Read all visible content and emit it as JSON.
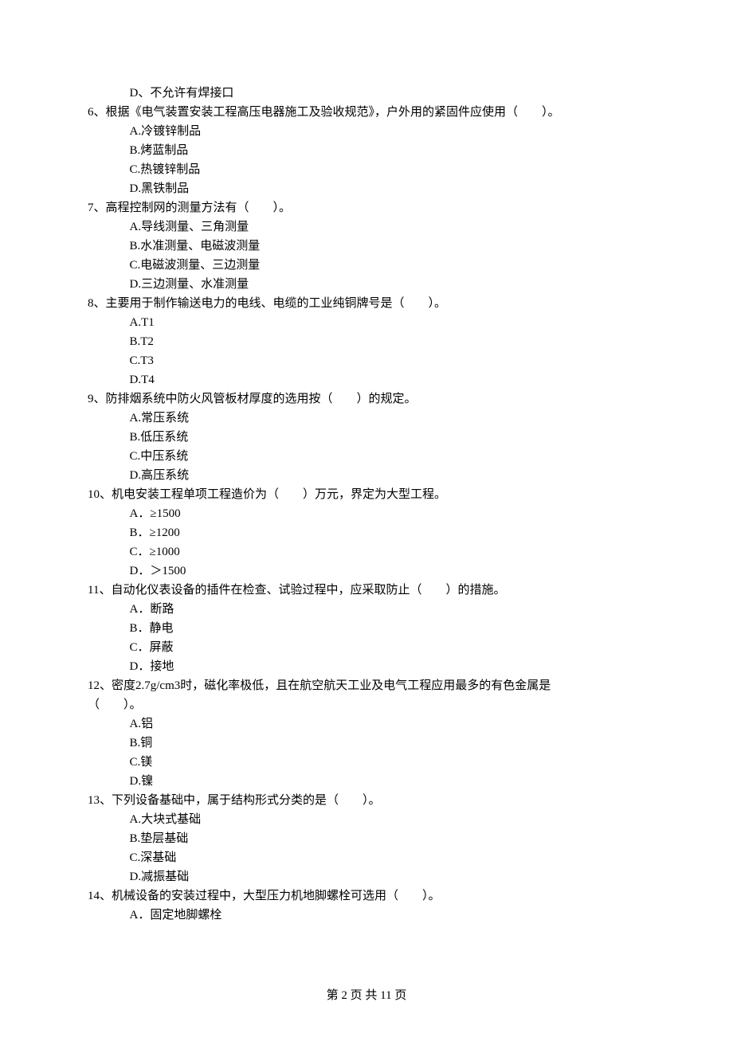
{
  "q5": {
    "optD": "D、不允许有焊接口"
  },
  "q6": {
    "stem": "6、根据《电气装置安装工程高压电器施工及验收规范》，户外用的紧固件应使用（　　）。",
    "optA": "A.冷镀锌制品",
    "optB": "B.烤蓝制品",
    "optC": "C.热镀锌制品",
    "optD": "D.黑铁制品"
  },
  "q7": {
    "stem": "7、高程控制网的测量方法有（　　）。",
    "optA": "A.导线测量、三角测量",
    "optB": "B.水准测量、电磁波测量",
    "optC": "C.电磁波测量、三边测量",
    "optD": "D.三边测量、水准测量"
  },
  "q8": {
    "stem": "8、主要用于制作输送电力的电线、电缆的工业纯铜牌号是（　　）。",
    "optA": "A.T1",
    "optB": "B.T2",
    "optC": "C.T3",
    "optD": "D.T4"
  },
  "q9": {
    "stem": "9、防排烟系统中防火风管板材厚度的选用按（　　）的规定。",
    "optA": "A.常压系统",
    "optB": "B.低压系统",
    "optC": "C.中压系统",
    "optD": "D.高压系统"
  },
  "q10": {
    "stem": "10、机电安装工程单项工程造价为（　　）万元，界定为大型工程。",
    "optA": "A．≥1500",
    "optB": "B．≥1200",
    "optC": "C．≥1000",
    "optD": "D．＞1500"
  },
  "q11": {
    "stem": "11、自动化仪表设备的插件在检查、试验过程中，应采取防止（　　）的措施。",
    "optA": "A．断路",
    "optB": "B．静电",
    "optC": "C．屏蔽",
    "optD": "D．接地"
  },
  "q12": {
    "stem1": "12、密度2.7g/cm3时，磁化率极低，且在航空航天工业及电气工程应用最多的有色金属是",
    "stem2": "（　　）。",
    "optA": "A.铝",
    "optB": "B.铜",
    "optC": "C.镁",
    "optD": "D.镍"
  },
  "q13": {
    "stem": "13、下列设备基础中，属于结构形式分类的是（　　）。",
    "optA": "A.大块式基础",
    "optB": "B.垫层基础",
    "optC": "C.深基础",
    "optD": "D.减振基础"
  },
  "q14": {
    "stem": "14、机械设备的安装过程中，大型压力机地脚螺栓可选用（　　）。",
    "optA": "A．固定地脚螺栓"
  },
  "footer": "第 2 页 共 11 页"
}
